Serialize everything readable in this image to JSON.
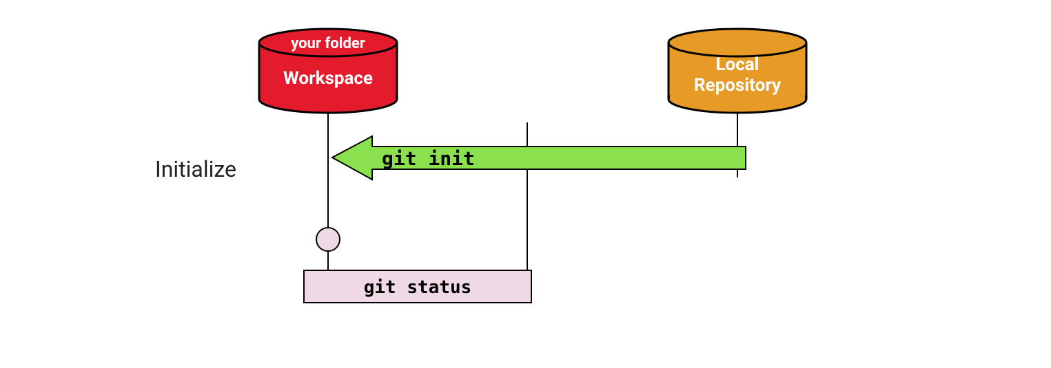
{
  "diagram": {
    "side_label": "Initialize",
    "workspace": {
      "caption": "your folder",
      "title": "Workspace",
      "fill": "#e31b2c"
    },
    "local_repo": {
      "title_line1": "Local",
      "title_line2": "Repository",
      "fill": "#e89a27"
    },
    "arrow": {
      "label": "git init",
      "fill": "#8be04e"
    },
    "status_box": {
      "label": "git status",
      "fill": "#efd9e4"
    },
    "node": {
      "fill": "#efd9e4"
    }
  }
}
